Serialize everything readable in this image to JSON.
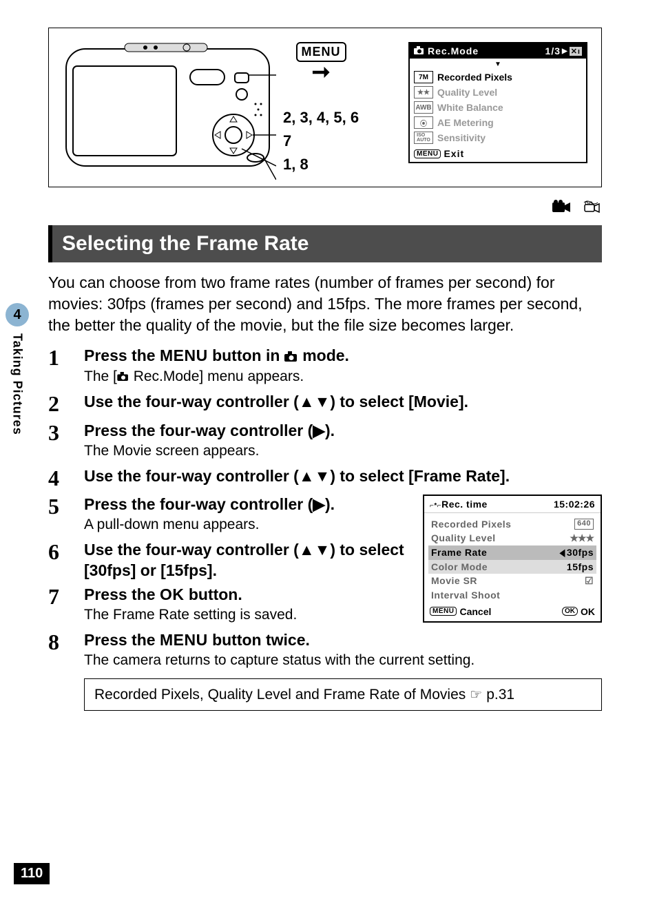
{
  "page_number": "110",
  "side_tab": {
    "chapter": "4",
    "label": "Taking Pictures"
  },
  "top_figure": {
    "labels": {
      "menu_button": "MENU",
      "line1": "2, 3, 4, 5, 6",
      "line2": "7",
      "line3": "1, 8"
    },
    "lcd": {
      "header_title": "Rec.Mode",
      "header_page": "1/3",
      "rows": [
        {
          "icon": "7M",
          "label": "Recorded Pixels",
          "selected": true
        },
        {
          "icon": "★★",
          "label": "Quality Level",
          "selected": false
        },
        {
          "icon": "AWB",
          "label": "White Balance",
          "selected": false
        },
        {
          "icon": "⦿",
          "label": "AE Metering",
          "selected": false
        },
        {
          "icon": "ISO\nAUTO",
          "label": "Sensitivity",
          "selected": false
        }
      ],
      "footer_label": "Exit"
    }
  },
  "mode_icons": {
    "movie": "🎥",
    "underwater_movie": "underwater-movie"
  },
  "section_title": "Selecting the Frame Rate",
  "intro": "You can choose from two frame rates (number of frames per second) for movies: 30fps (frames per second) and 15fps. The more frames per second, the better the quality of the movie, but the file size becomes larger.",
  "steps": [
    {
      "num": "1",
      "title_pre": "Press the ",
      "title_strong": "MENU",
      "title_mid": " button in ",
      "title_icon": "camera",
      "title_post": " mode.",
      "desc_pre": "The [",
      "desc_icon": "camera",
      "desc_post": " Rec.Mode] menu appears."
    },
    {
      "num": "2",
      "title": "Use the four-way controller (▲▼) to select [Movie]."
    },
    {
      "num": "3",
      "title": "Press the four-way controller (▶).",
      "desc": "The Movie screen appears."
    },
    {
      "num": "4",
      "title": "Use the four-way controller (▲▼) to select [Frame Rate]."
    },
    {
      "num": "5",
      "title": "Press the four-way controller (▶).",
      "desc": "A pull-down menu appears."
    },
    {
      "num": "6",
      "title": "Use the four-way controller (▲▼) to select [30fps] or [15fps]."
    },
    {
      "num": "7",
      "title_pre": "Press the ",
      "title_strong": "OK",
      "title_post": " button.",
      "desc": "The Frame Rate setting is saved."
    },
    {
      "num": "8",
      "title_pre": "Press the ",
      "title_strong": "MENU",
      "title_post": " button twice.",
      "desc": "The camera returns to capture status with the current setting."
    }
  ],
  "lcd2": {
    "header_left": "Rec. time",
    "header_right": "15:02:26",
    "rows": [
      {
        "label": "Recorded Pixels",
        "value": "640",
        "boxed": true
      },
      {
        "label": "Quality Level",
        "value": "★★★"
      },
      {
        "label": "Frame Rate",
        "value": "30fps",
        "selected": true,
        "left_tri": true
      },
      {
        "label": "Color Mode",
        "value": "15fps",
        "highlighted": true
      },
      {
        "label": "Movie SR",
        "value": "☑"
      },
      {
        "label": "Interval Shoot",
        "value": ""
      }
    ],
    "footer_left_label": "Cancel",
    "footer_right_label": "OK"
  },
  "ref_box": {
    "text": "Recorded Pixels, Quality Level and Frame Rate of Movies ",
    "page": "p.31"
  }
}
